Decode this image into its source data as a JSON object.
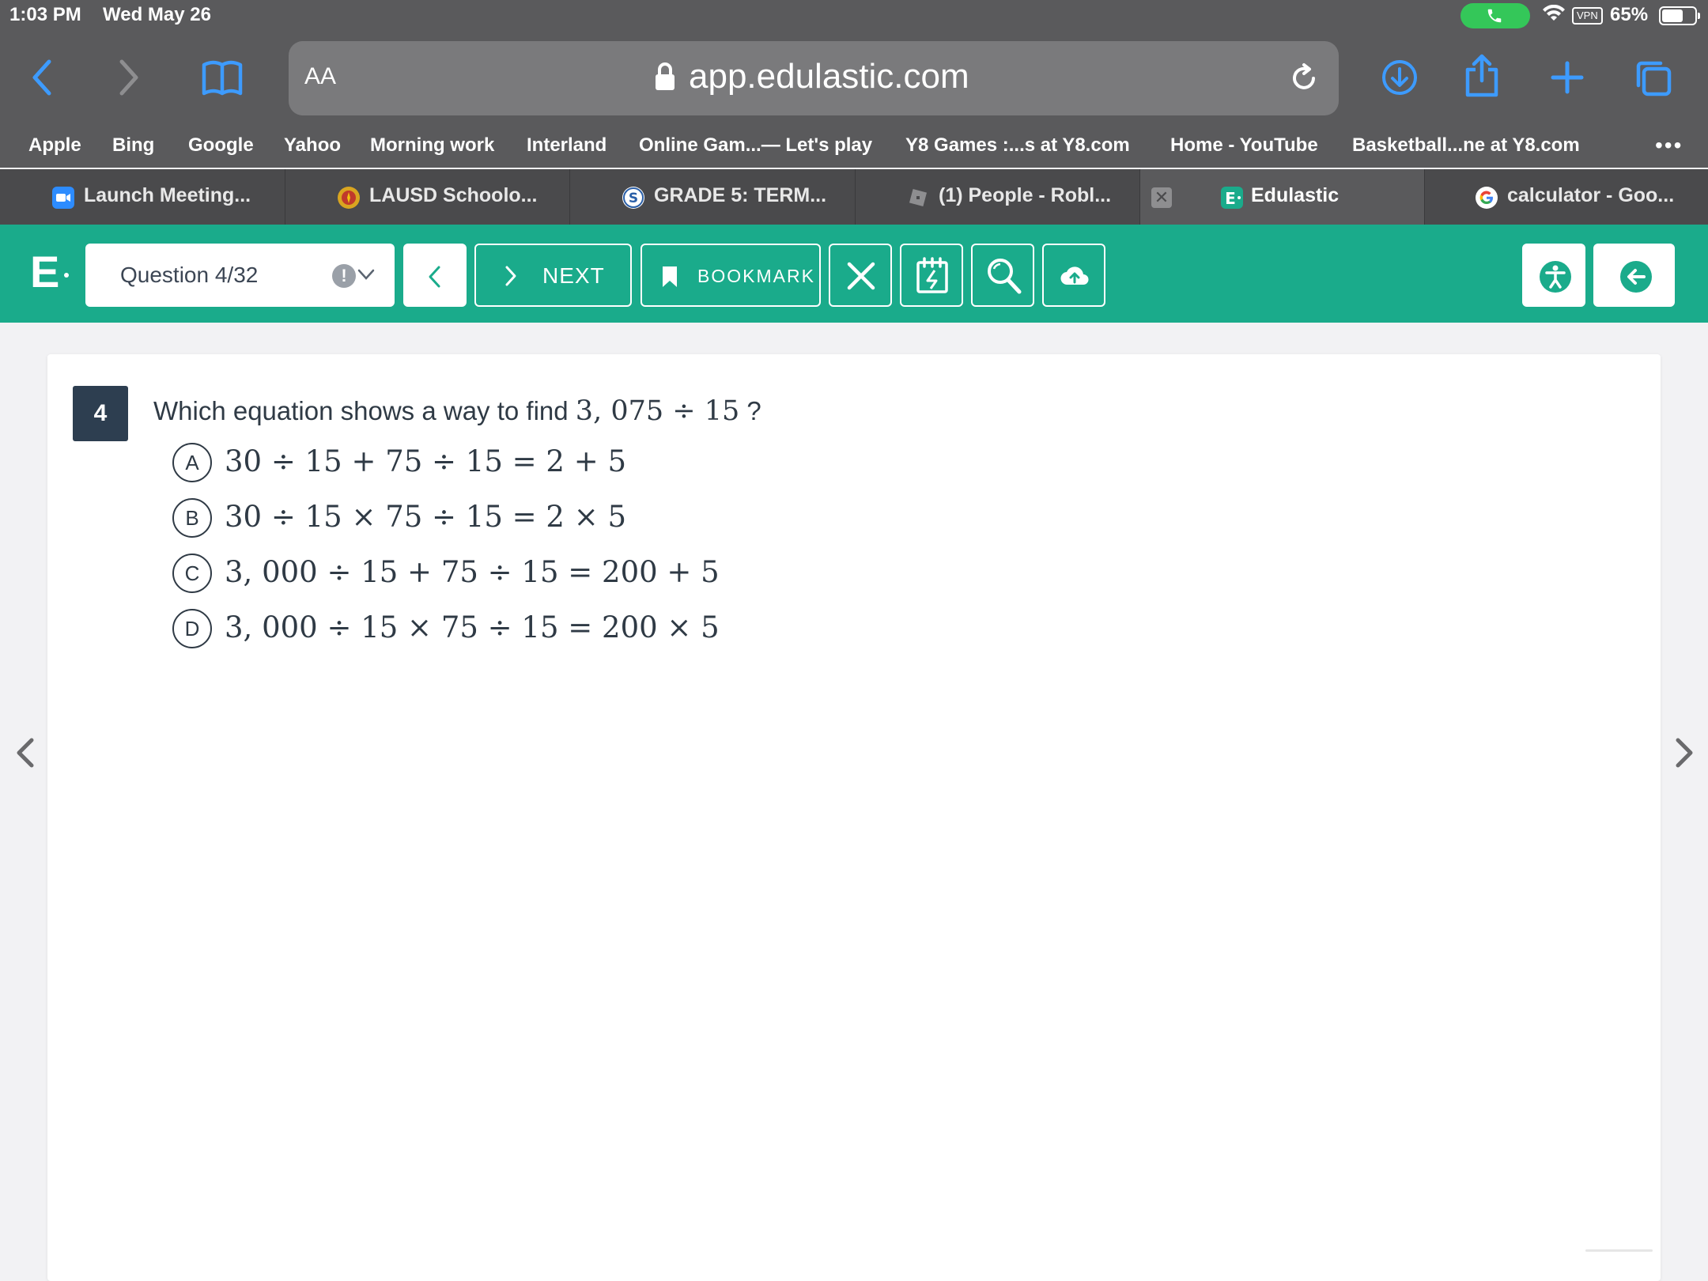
{
  "status_bar": {
    "time": "1:03 PM",
    "date": "Wed May 26",
    "vpn": "VPN",
    "battery_pct": "65%",
    "battery_level": 0.65
  },
  "toolbar": {
    "text_size": "AA",
    "url": "app.edulastic.com"
  },
  "bookmarks": [
    "Apple",
    "Bing",
    "Google",
    "Yahoo",
    "Morning work",
    "Interland",
    "Online Gam...— Let's play",
    "Y8 Games :...s at Y8.com",
    "Home - YouTube",
    "Basketball...ne at Y8.com"
  ],
  "bookmarks_more": "•••",
  "tabs": [
    {
      "label": "Launch Meeting...",
      "icon": "zoom-icon"
    },
    {
      "label": "LAUSD Schoolo...",
      "icon": "lausd-icon"
    },
    {
      "label": "GRADE 5: TERM...",
      "icon": "schoology-icon"
    },
    {
      "label": "(1) People - Robl...",
      "icon": "roblox-icon"
    },
    {
      "label": "Edulastic",
      "icon": "edulastic-icon",
      "active": true
    },
    {
      "label": "calculator - Goo...",
      "icon": "google-icon"
    }
  ],
  "app": {
    "logo": "E",
    "question_selector": "Question 4/32",
    "warn_mark": "!",
    "next_label": "NEXT",
    "bookmark_label": "BOOKMARK",
    "accent_color": "#1aab8b"
  },
  "question": {
    "number": "4",
    "prompt": "Which equation shows a way to find",
    "prompt_math": "3, 075 ÷ 15",
    "prompt_end": "?",
    "choices": [
      {
        "letter": "A",
        "equation": "30 ÷ 15 + 75 ÷ 15 = 2 + 5"
      },
      {
        "letter": "B",
        "equation": "30 ÷ 15 × 75 ÷ 15 = 2  × 5"
      },
      {
        "letter": "C",
        "equation": "3, 000 ÷ 15 + 75 ÷ 15 = 200 + 5"
      },
      {
        "letter": "D",
        "equation": "3, 000 ÷ 15 × 75 ÷ 15 = 200 × 5"
      }
    ]
  }
}
